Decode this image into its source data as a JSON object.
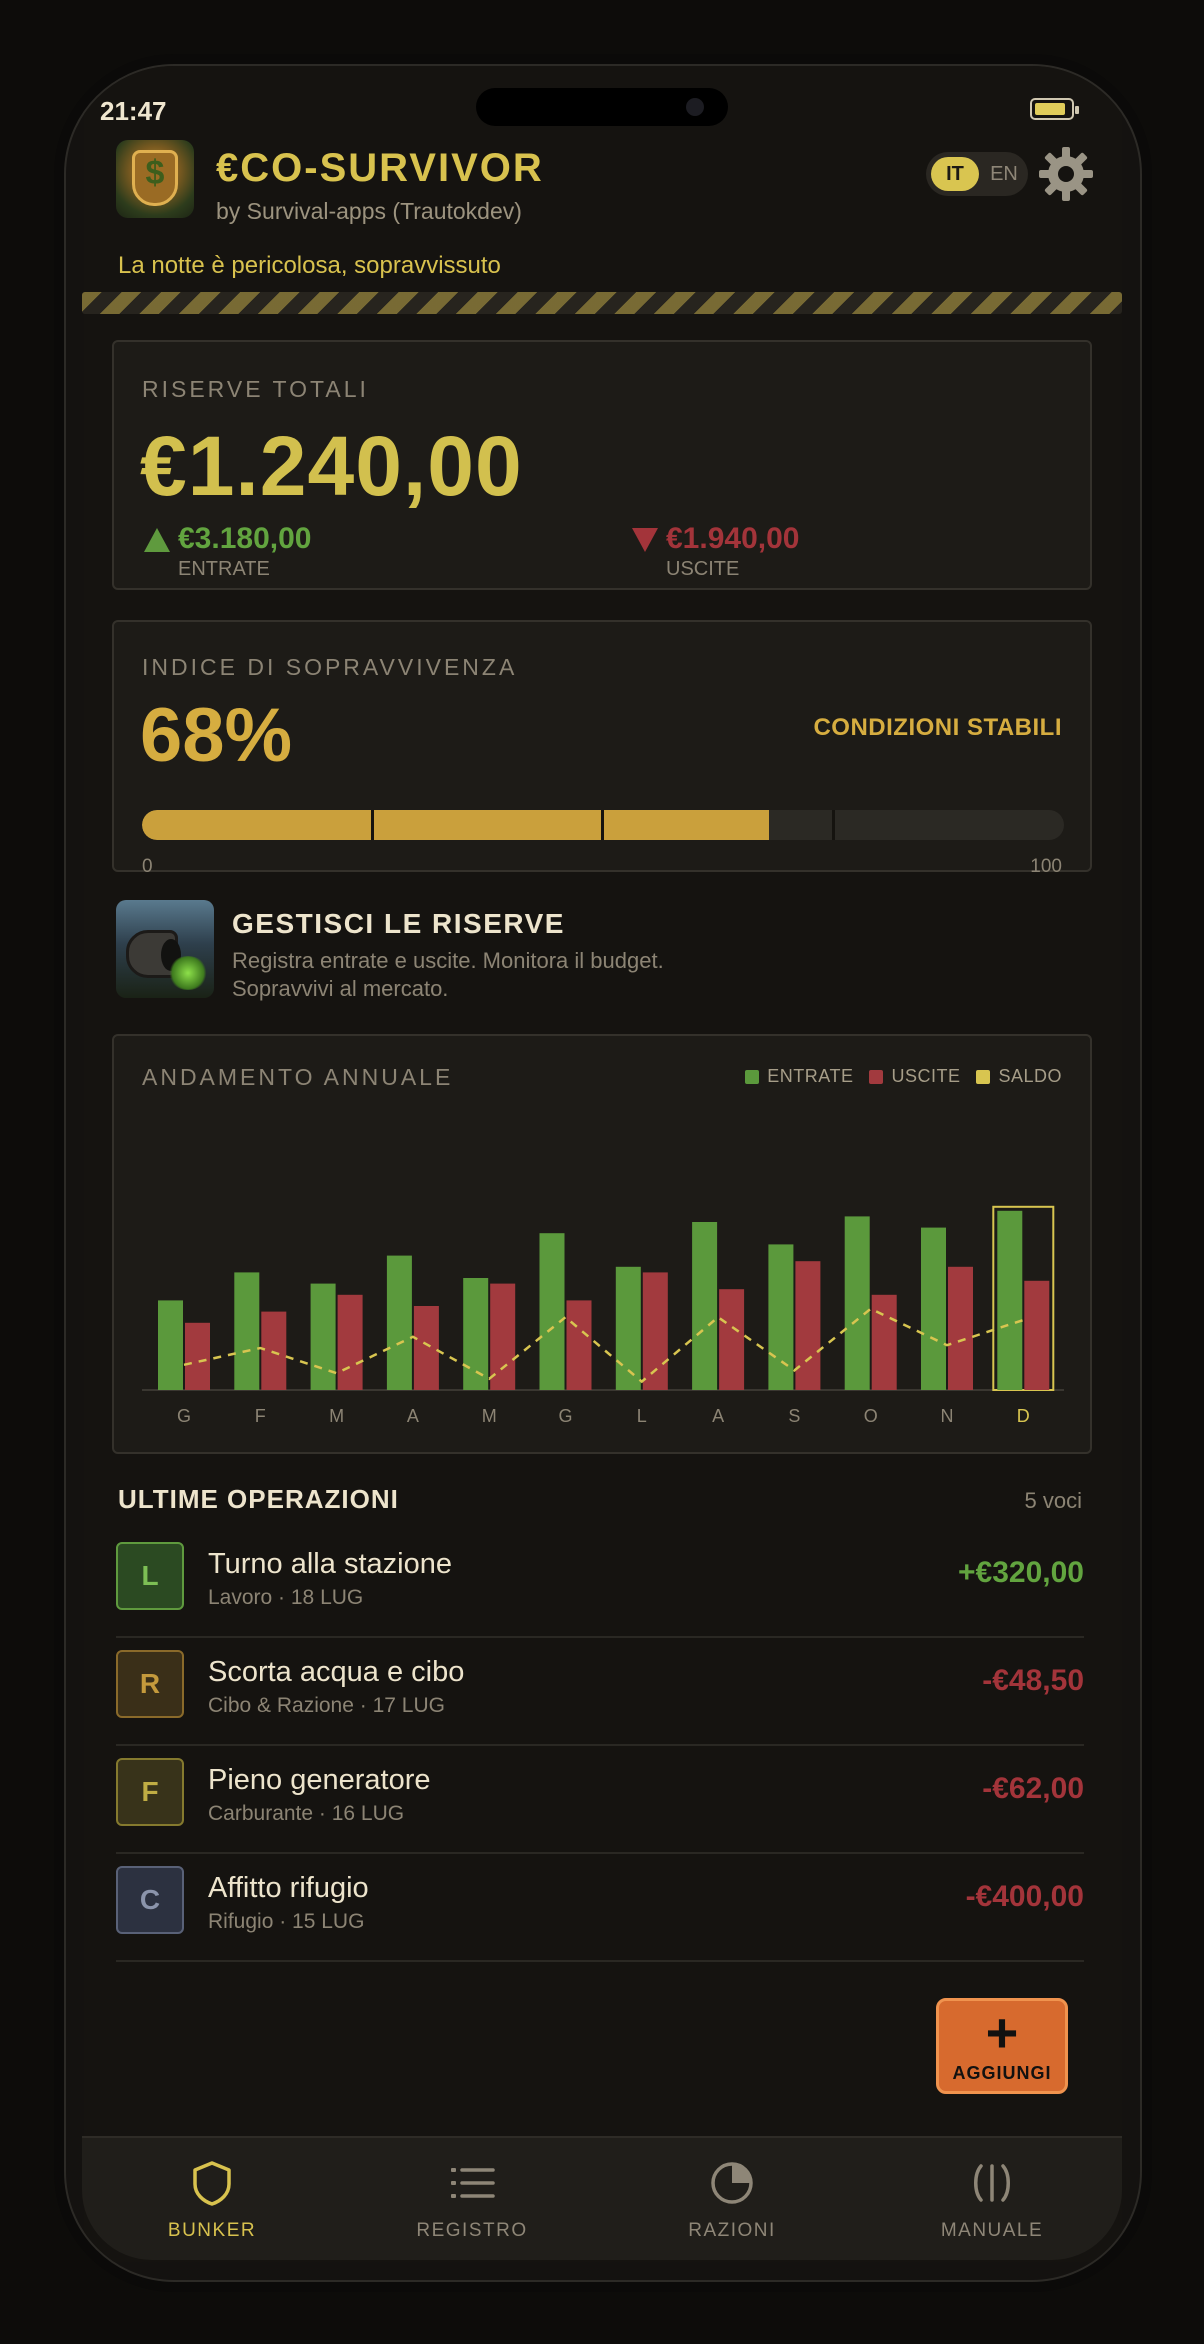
{
  "status_bar": {
    "time": "21:47"
  },
  "header": {
    "app_title": "€CO-SURVIVOR",
    "subtitle": "by Survival-apps (Trautokdev)",
    "lang_active": "IT",
    "lang_other": "EN",
    "tagline": "La notte è pericolosa, sopravvissuto"
  },
  "reserves": {
    "label": "RISERVE TOTALI",
    "total": "€1.240,00",
    "income_value": "€3.180,00",
    "income_label": "ENTRATE",
    "expense_value": "€1.940,00",
    "expense_label": "USCITE"
  },
  "survival": {
    "label": "INDICE DI SOPRAVVIVENZA",
    "percent_text": "68%",
    "percent": 68,
    "status": "CONDIZIONI STABILI",
    "min_label": "0",
    "max_label": "100"
  },
  "promo": {
    "title": "GESTISCI LE RISERVE",
    "line1": "Registra entrate e uscite. Monitora il budget.",
    "line2": "Sopravvivi al mercato."
  },
  "chart_data": {
    "type": "bar",
    "title": "ANDAMENTO ANNUALE",
    "categories": [
      "G",
      "F",
      "M",
      "A",
      "M",
      "G",
      "L",
      "A",
      "S",
      "O",
      "N",
      "D"
    ],
    "highlighted_category_index": 11,
    "legend_position": "top-right",
    "grid": false,
    "ylim": [
      0,
      100
    ],
    "series": [
      {
        "name": "ENTRATE",
        "kind": "bar",
        "color": "#5b993c",
        "values": [
          32,
          42,
          38,
          48,
          40,
          56,
          44,
          60,
          52,
          62,
          58,
          64
        ]
      },
      {
        "name": "USCITE",
        "kind": "bar",
        "color": "#a23a3e",
        "values": [
          24,
          28,
          34,
          30,
          38,
          32,
          42,
          36,
          46,
          34,
          44,
          39
        ]
      },
      {
        "name": "SALDO",
        "kind": "line",
        "color": "#d8c550",
        "values": [
          9,
          15,
          6,
          19,
          4,
          26,
          3,
          26,
          7,
          29,
          16,
          25
        ]
      }
    ]
  },
  "operations": {
    "title": "ULTIME OPERAZIONI",
    "count": "5 voci",
    "items": [
      {
        "initial": "L",
        "name": "Turno alla stazione",
        "meta": "Lavoro · 18 LUG",
        "amount": "+€320,00",
        "amount_color": "#62a43f",
        "badge_bg": "#2b4a22",
        "badge_border": "#5f9a3e",
        "badge_text": "#7dbf55"
      },
      {
        "initial": "R",
        "name": "Scorta acqua e cibo",
        "meta": "Cibo & Razione · 17 LUG",
        "amount": "-€48,50",
        "amount_color": "#a3343a",
        "badge_bg": "#3a2f18",
        "badge_border": "#8a6a2a",
        "badge_text": "#c49a3c"
      },
      {
        "initial": "F",
        "name": "Pieno generatore",
        "meta": "Carburante · 16 LUG",
        "amount": "-€62,00",
        "amount_color": "#a3343a",
        "badge_bg": "#38331a",
        "badge_border": "#857a2e",
        "badge_text": "#c0ad44"
      },
      {
        "initial": "C",
        "name": "Affitto rifugio",
        "meta": "Rifugio · 15 LUG",
        "amount": "-€400,00",
        "amount_color": "#a3343a",
        "badge_bg": "#2c3140",
        "badge_border": "#596177",
        "badge_text": "#8b94ab"
      }
    ]
  },
  "fab": {
    "icon": "plus-icon",
    "label": "AGGIUNGI"
  },
  "tabbar": {
    "items": [
      {
        "label": "BUNKER",
        "icon": "shield-icon",
        "active": true
      },
      {
        "label": "REGISTRO",
        "icon": "list-icon",
        "active": false
      },
      {
        "label": "RAZIONI",
        "icon": "pie-icon",
        "active": false
      },
      {
        "label": "MANUALE",
        "icon": "manual-icon",
        "active": false
      }
    ]
  },
  "colors": {
    "accent": "#d8c24e",
    "income": "#62a43f",
    "expense": "#a3343a",
    "survival": "#caa03c",
    "fab": "#d76a2e"
  }
}
